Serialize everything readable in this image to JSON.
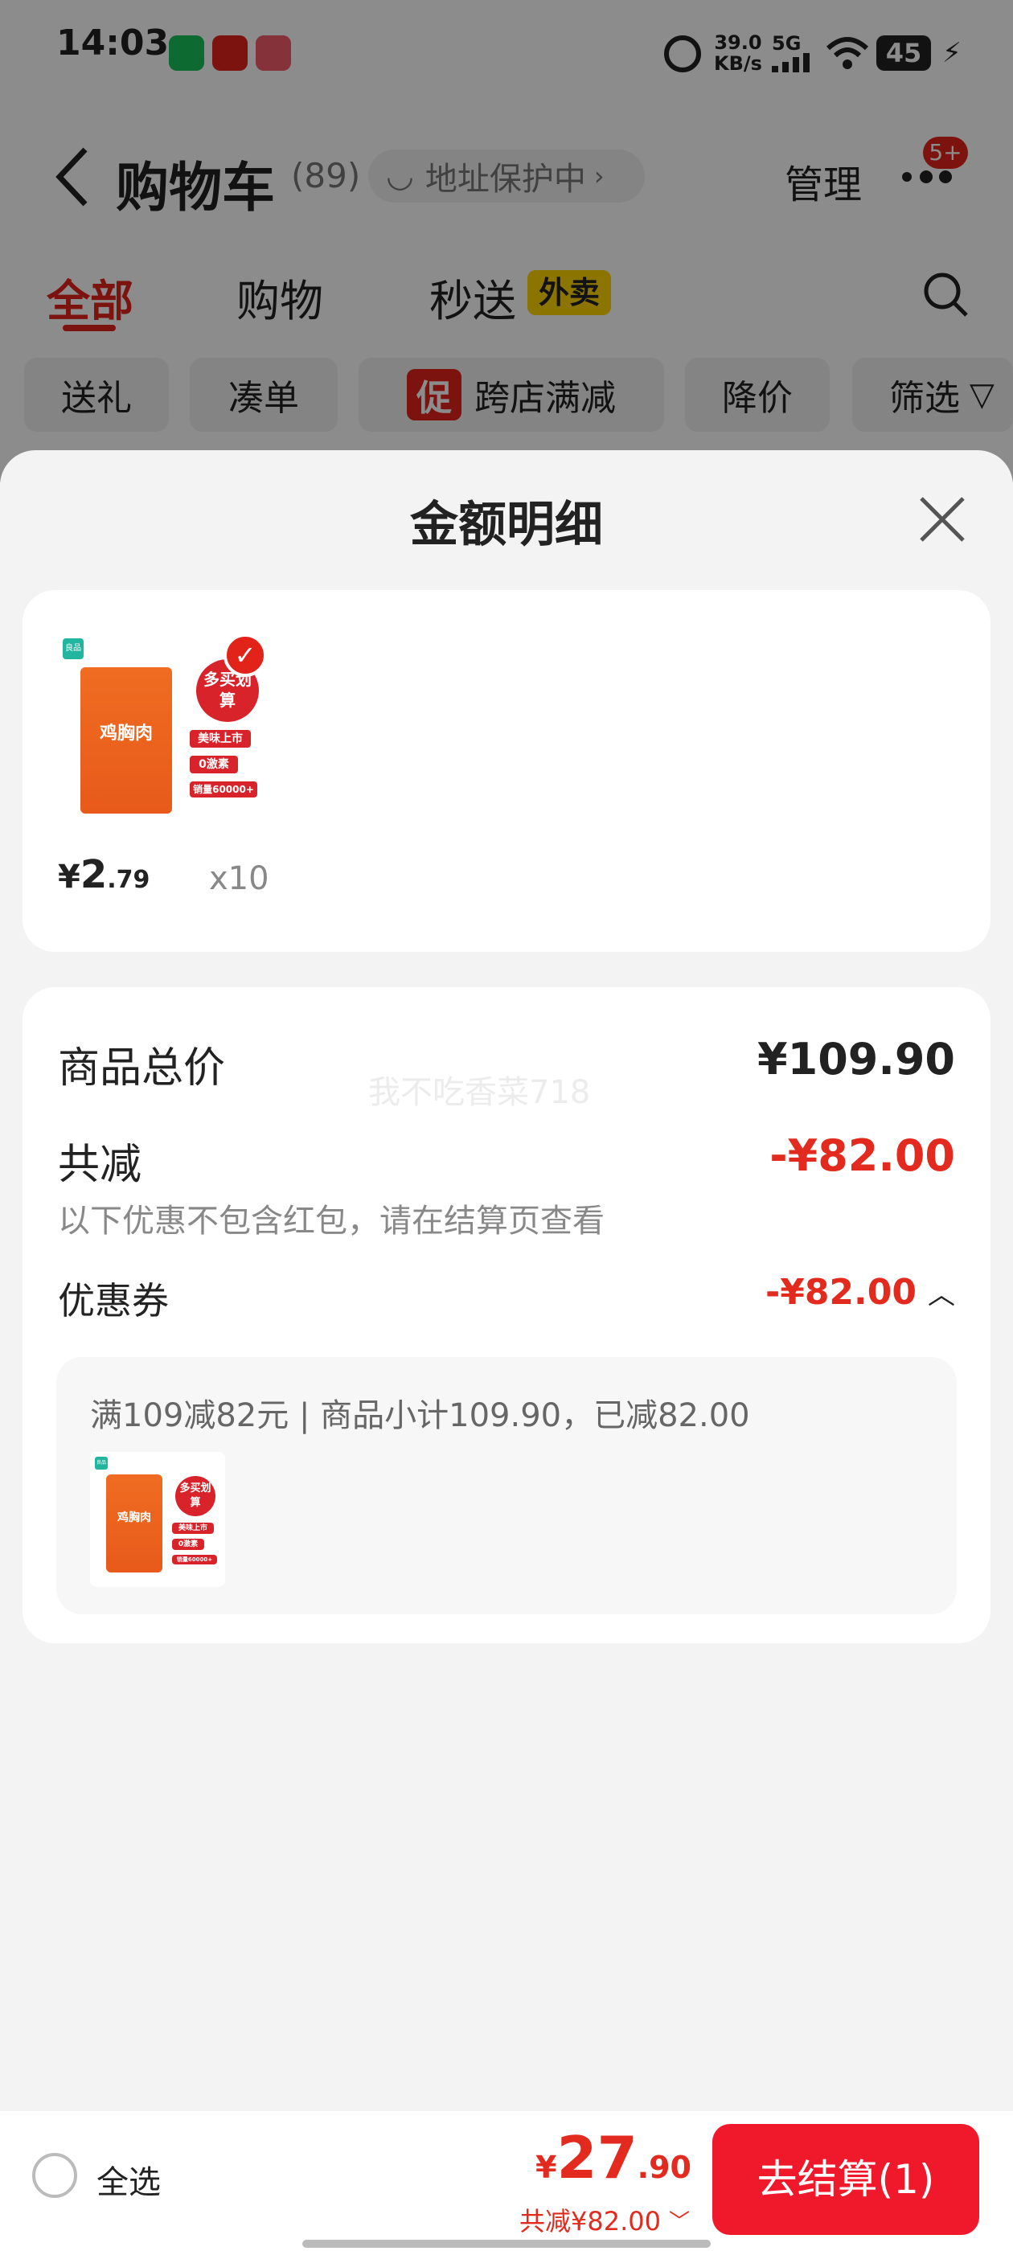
{
  "status_bar": {
    "time": "14:03",
    "speed_top": "39.0",
    "speed_unit": "KB/s",
    "network": "5G",
    "battery": "45"
  },
  "header": {
    "back_icon": "back-arrow-icon",
    "title": "购物车",
    "count": "(89)",
    "address": "地址保护中",
    "manage": "管理",
    "badge": "5+"
  },
  "tabs": [
    {
      "label": "全部"
    },
    {
      "label": "购物"
    },
    {
      "label": "秒送"
    }
  ],
  "tab_badge": "外卖",
  "filters": {
    "gift": "送礼",
    "combine": "凑单",
    "promo_tag": "促",
    "cross_store": "跨店满减",
    "price_drop": "降价",
    "filter": "筛选"
  },
  "sheet": {
    "title": "金额明细",
    "product": {
      "img_brand": "良品",
      "img_name": "鸡胸肉",
      "img_badge": "多买划算",
      "img_tag1": "美味上市",
      "img_tag2": "0激素",
      "img_tag3": "销量60000+",
      "price_symbol": "¥",
      "price_int": "2",
      "price_dec": ".79",
      "qty": "x10"
    },
    "summary": {
      "total_label": "商品总价",
      "total_value": "¥109.90",
      "watermark": "我不吃香菜718",
      "discount_label": "共减",
      "discount_value": "-¥82.00",
      "discount_note": "以下优惠不包含红包，请在结算页查看",
      "coupon_label": "优惠券",
      "coupon_value": "-¥82.00",
      "coupon_detail": "满109减82元 | 商品小计109.90，已减82.00"
    }
  },
  "bottom_bar": {
    "select_all": "全选",
    "pay_symbol": "¥",
    "pay_int": "27",
    "pay_dec": ".90",
    "saved": "共减¥82.00",
    "checkout": "去结算(1)"
  },
  "colors": {
    "accent": "#e22b1e",
    "button": "#f0192b"
  }
}
